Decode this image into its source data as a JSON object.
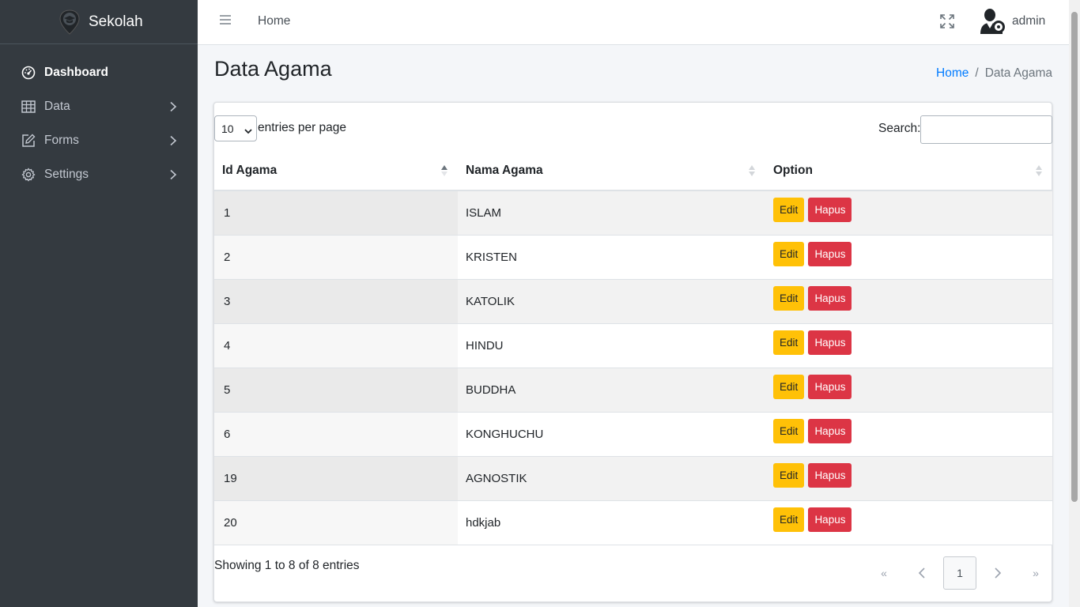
{
  "brand": {
    "name": "Sekolah",
    "logo_icon": "school-shield-icon"
  },
  "sidebar": {
    "items": [
      {
        "label": "Dashboard",
        "icon": "gauge-icon",
        "active": true,
        "has_submenu": false
      },
      {
        "label": "Data",
        "icon": "table-icon",
        "active": false,
        "has_submenu": true
      },
      {
        "label": "Forms",
        "icon": "edit-icon",
        "active": false,
        "has_submenu": true
      },
      {
        "label": "Settings",
        "icon": "gear-icon",
        "active": false,
        "has_submenu": true
      }
    ]
  },
  "topbar": {
    "menu_icon": "hamburger-icon",
    "home_link": "Home",
    "fullscreen_icon": "fullscreen-icon",
    "user_name": "admin",
    "avatar_icon": "user-gear-icon"
  },
  "page": {
    "title": "Data Agama",
    "breadcrumb": {
      "home": "Home",
      "separator": "/",
      "current": "Data Agama"
    }
  },
  "table_controls": {
    "page_length_value": "10",
    "page_length_text": "entries per page",
    "search_label": "Search:",
    "search_value": ""
  },
  "table": {
    "columns": [
      "Id Agama",
      "Nama Agama",
      "Option"
    ],
    "sorted_column": "Id Agama",
    "sort_direction": "ascending",
    "rows": [
      {
        "id": "1",
        "name": "ISLAM"
      },
      {
        "id": "2",
        "name": "KRISTEN"
      },
      {
        "id": "3",
        "name": "KATOLIK"
      },
      {
        "id": "4",
        "name": "HINDU"
      },
      {
        "id": "5",
        "name": "BUDDHA"
      },
      {
        "id": "6",
        "name": "KONGHUCHU"
      },
      {
        "id": "19",
        "name": "AGNOSTIK"
      },
      {
        "id": "20",
        "name": "hdkjab"
      }
    ],
    "edit_label": "Edit",
    "delete_label": "Hapus"
  },
  "footer": {
    "info": "Showing 1 to 8 of 8 entries",
    "pagination": {
      "first": "«",
      "prev": "‹",
      "current_page": "1",
      "next": "›",
      "last": "»"
    }
  },
  "colors": {
    "sidebar_bg": "#343a40",
    "link_blue": "#007bff",
    "edit_yellow": "#ffc107",
    "delete_red": "#dc3545"
  }
}
